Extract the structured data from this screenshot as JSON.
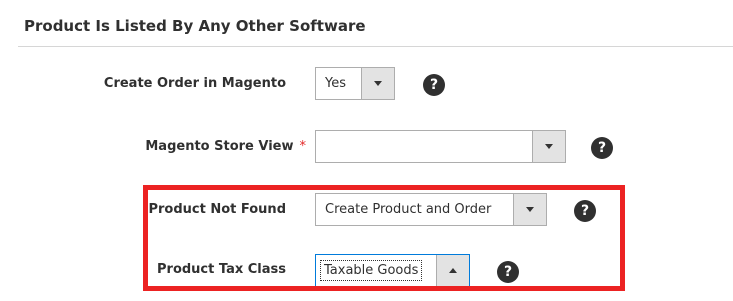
{
  "section": {
    "title": "Product Is Listed By Any Other Software"
  },
  "fields": {
    "create_order": {
      "label": "Create Order in Magento",
      "value": "Yes",
      "help_icon": "question-icon"
    },
    "store_view": {
      "label": "Magento Store View",
      "required_mark": "*",
      "value": "",
      "help_icon": "question-icon"
    },
    "product_not_found": {
      "label": "Product Not Found",
      "value": "Create Product and Order",
      "help_icon": "question-icon"
    },
    "tax_class": {
      "label": "Product Tax Class",
      "value": "Taxable Goods",
      "help_icon": "question-icon"
    }
  },
  "help_glyph": "?",
  "colors": {
    "highlight": "#ec2222",
    "required": "#e22626",
    "focus": "#007bdb"
  }
}
